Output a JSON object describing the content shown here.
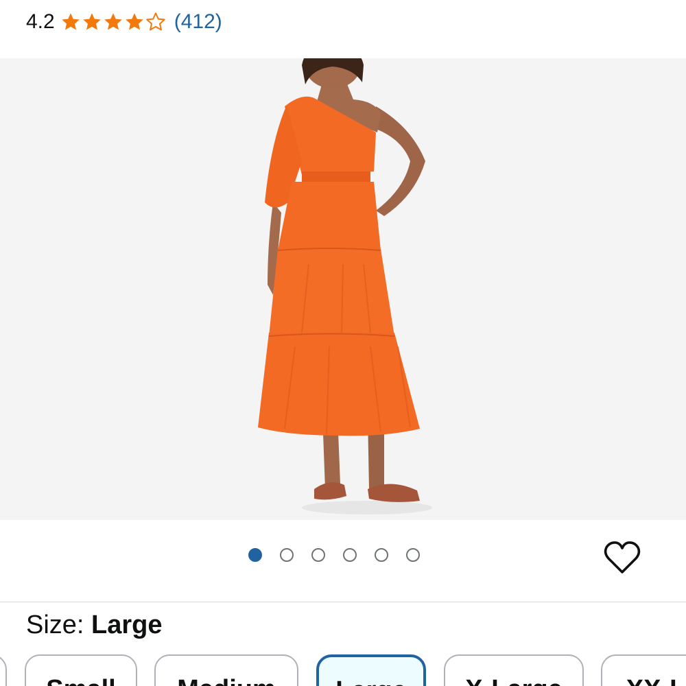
{
  "rating": {
    "value": "4.2",
    "stars": 4.2,
    "count": "(412)",
    "star_color": "#f3790c",
    "count_color": "#2162a1"
  },
  "product_image": {
    "background": "#f4f4f4",
    "dress_color": "#f26a24"
  },
  "carousel": {
    "total": 6,
    "active_index": 0,
    "active_color": "#2162a1"
  },
  "wishlist": {
    "icon": "heart-outline-icon"
  },
  "size": {
    "label": "Size:",
    "selected": "Large",
    "options": [
      "Small",
      "Medium",
      "Large",
      "X-Large",
      "XX-L"
    ],
    "selected_border_color": "#2162a1"
  }
}
